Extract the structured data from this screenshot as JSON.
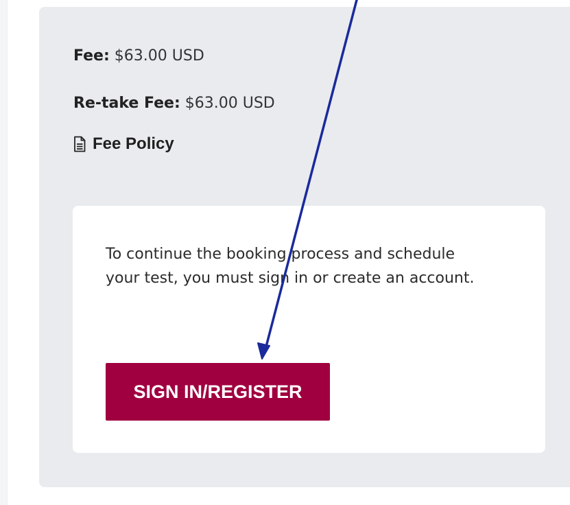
{
  "fees": {
    "fee_label": "Fee:",
    "fee_value": "$63.00 USD",
    "retake_label": "Re-take Fee:",
    "retake_value": "$63.00 USD"
  },
  "policy": {
    "label": "Fee Policy",
    "icon": "document-icon"
  },
  "signin_card": {
    "message": "To continue the booking process and schedule your test, you must sign in or create an account.",
    "button_label": "SIGN IN/REGISTER"
  },
  "colors": {
    "panel_background": "#e9ebee",
    "button_background": "#a0003f",
    "annotation_arrow": "#1a2a9c"
  }
}
